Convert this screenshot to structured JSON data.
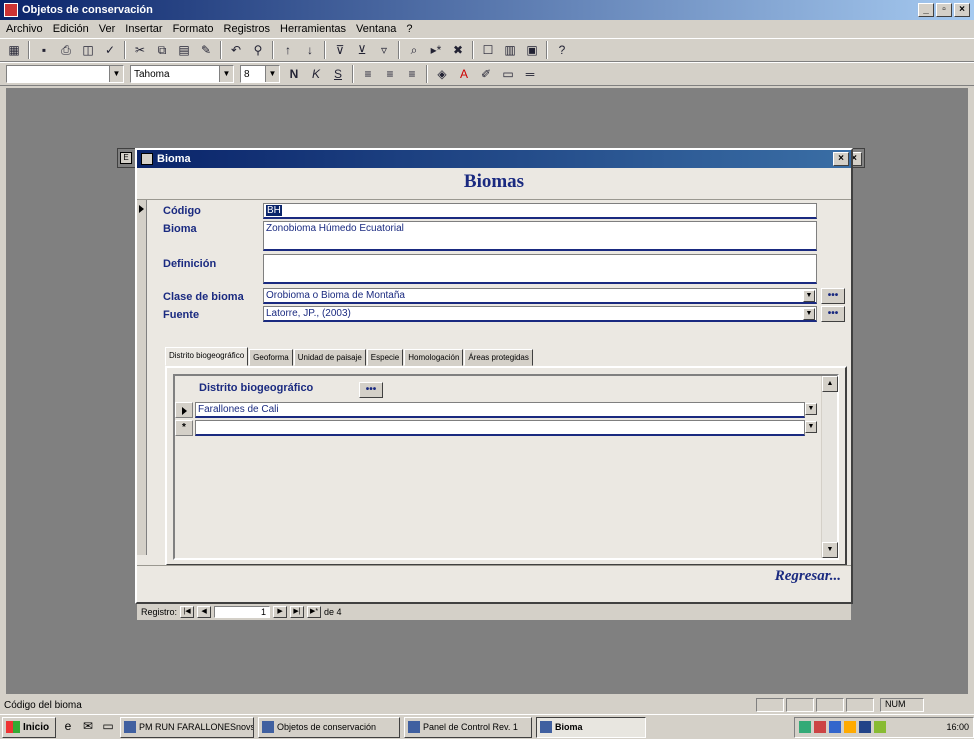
{
  "app": {
    "title": "Objetos de conservación",
    "window_controls": [
      "_",
      "▫",
      "×"
    ]
  },
  "menu": [
    "Archivo",
    "Edición",
    "Ver",
    "Insertar",
    "Formato",
    "Registros",
    "Herramientas",
    "Ventana",
    "?"
  ],
  "format_toolbar": {
    "object_combo": "",
    "font_name": "Tahoma",
    "font_size": "8"
  },
  "form": {
    "title": "Bioma",
    "heading": "Biomas",
    "fields": {
      "codigo": {
        "label": "Código",
        "value": "BH"
      },
      "bioma": {
        "label": "Bioma",
        "value": "Zonobioma Húmedo Ecuatorial"
      },
      "definicion": {
        "label": "Definición",
        "value": ""
      },
      "clase": {
        "label": "Clase de bioma",
        "value": "Orobioma o Bioma de Montaña"
      },
      "fuente": {
        "label": "Fuente",
        "value": "Latorre, JP., (2003)"
      }
    },
    "ellipsis": "•••",
    "tabs": [
      "Distrito biogeográfico",
      "Geoforma",
      "Unidad de paisaje",
      "Especie",
      "Homologación",
      "Áreas protegidas"
    ],
    "active_tab": 0,
    "subform": {
      "header": "Distrito biogeográfico",
      "rows": [
        "Farallones de Cali",
        ""
      ],
      "new_row_marker": "*"
    },
    "return_label": "Regresar...",
    "nav": {
      "label": "Registro:",
      "current": "1",
      "of_text": "de 4"
    }
  },
  "status": {
    "text": "Código del bioma",
    "num": "NUM"
  },
  "taskbar": {
    "start": "Inicio",
    "tasks": [
      "PM RUN FARALLONESnovs...",
      "Objetos de conservación",
      "Panel de Control  Rev. 1",
      "Bioma"
    ],
    "active_task": 3,
    "clock": "16:00"
  }
}
